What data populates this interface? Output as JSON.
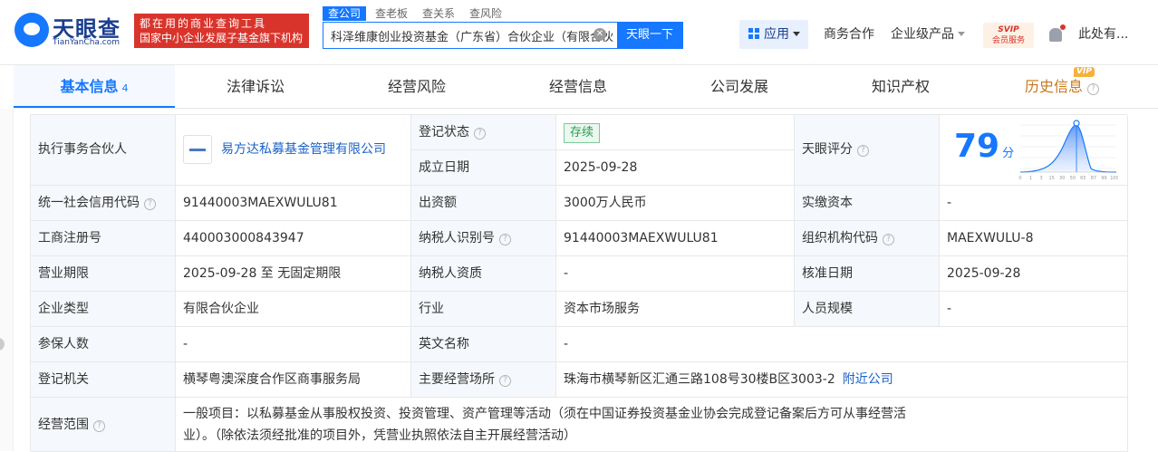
{
  "header": {
    "logo_name": "天眼查",
    "logo_sub": "TianYanCha.com",
    "slogan_line1": "都在用的商业查询工具",
    "slogan_line2": "国家中小企业发展子基金旗下机构",
    "search_tabs": [
      "查公司",
      "查老板",
      "查关系",
      "查风险"
    ],
    "search_value": "科泽维康创业投资基金（广东省）合伙企业（有限合伙",
    "search_button": "天眼一下",
    "clear_glyph": "✕",
    "app_label": "应用",
    "business_label": "商务合作",
    "enterprise_label": "企业级产品",
    "svip_line1": "SVIP",
    "svip_line2": "会员服务",
    "user_label": "此处有..."
  },
  "tabs": {
    "basic": "基本信息",
    "basic_count": "4",
    "legal": "法律诉讼",
    "risk": "经营风险",
    "ops": "经营信息",
    "dev": "公司发展",
    "ip": "知识产权",
    "history": "历史信息",
    "vip_badge": "VIP"
  },
  "info": {
    "partner_label": "执行事务合伙人",
    "partner_value": "易方达私募基金管理有限公司",
    "reg_status_label": "登记状态",
    "reg_status_value": "存续",
    "est_date_label": "成立日期",
    "est_date_value": "2025-09-28",
    "score_label": "天眼评分",
    "score_value": "79",
    "score_unit": "分",
    "credit_code_label": "统一社会信用代码",
    "credit_code_value": "91440003MAEXWULU81",
    "capital_label": "出资额",
    "capital_value": "3000万人民币",
    "paid_label": "实缴资本",
    "paid_value": "-",
    "reg_no_label": "工商注册号",
    "reg_no_value": "440003000843947",
    "taxpayer_id_label": "纳税人识别号",
    "taxpayer_id_value": "91440003MAEXWULU81",
    "org_code_label": "组织机构代码",
    "org_code_value": "MAEXWULU-8",
    "term_label": "营业期限",
    "term_value": "2025-09-28 至 无固定期限",
    "tax_quality_label": "纳税人资质",
    "tax_quality_value": "-",
    "approve_label": "核准日期",
    "approve_value": "2025-09-28",
    "type_label": "企业类型",
    "type_value": "有限合伙企业",
    "industry_label": "行业",
    "industry_value": "资本市场服务",
    "staff_label": "人员规模",
    "staff_value": "-",
    "insured_label": "参保人数",
    "insured_value": "-",
    "en_name_label": "英文名称",
    "en_name_value": "-",
    "authority_label": "登记机关",
    "authority_value": "横琴粤澳深度合作区商事服务局",
    "address_label": "主要经营场所",
    "address_value": "珠海市横琴新区汇通三路108号30楼B区3003-2",
    "nearby_label": "附近公司",
    "scope_label": "经营范围",
    "scope_line1": "一般项目：以私募基金从事股权投资、投资管理、资产管理等活动（须在中国证券投资基金业协会完成登记备案后方可从事经营活",
    "scope_line2": "业）。（除依法须经批准的项目外，凭营业执照依法自主开展经营活动）"
  },
  "score_curve": {
    "x_ticks": [
      "0",
      "1",
      "3",
      "15",
      "30",
      "50",
      "65",
      "87",
      "99",
      "100"
    ]
  },
  "colors": {
    "brand_blue": "#1677ff",
    "status_green": "#2c9a55",
    "history_orange": "#c8771b",
    "slogan_red": "#d9342b"
  }
}
